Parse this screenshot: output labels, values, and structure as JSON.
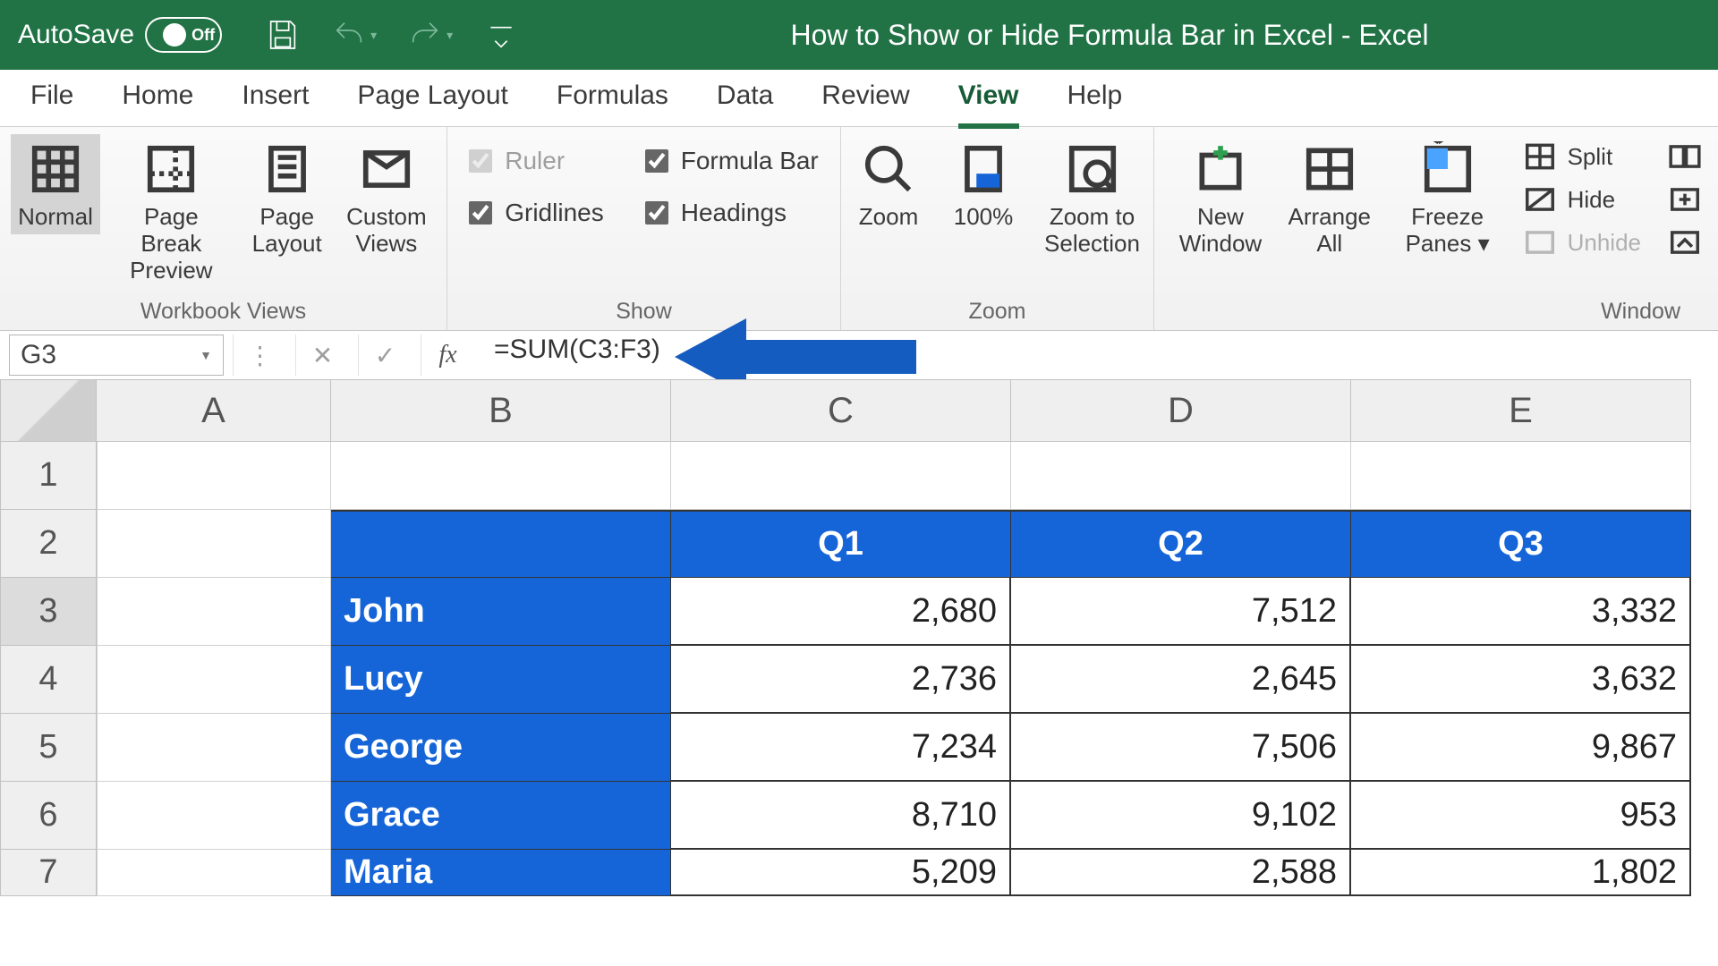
{
  "titlebar": {
    "autosave_label": "AutoSave",
    "autosave_state": "Off",
    "document_title": "How to Show or Hide Formula Bar in Excel  -  Excel"
  },
  "ribbon_tabs": [
    "File",
    "Home",
    "Insert",
    "Page Layout",
    "Formulas",
    "Data",
    "Review",
    "View",
    "Help"
  ],
  "active_tab": "View",
  "groups": {
    "workbook_views": {
      "label": "Workbook Views",
      "buttons": {
        "normal": "Normal",
        "page_break": "Page Break Preview",
        "page_layout": "Page Layout",
        "custom_views": "Custom Views"
      }
    },
    "show": {
      "label": "Show",
      "ruler": "Ruler",
      "formula_bar": "Formula Bar",
      "gridlines": "Gridlines",
      "headings": "Headings"
    },
    "zoom": {
      "label": "Zoom",
      "zoom": "Zoom",
      "hundred": "100%",
      "zoom_selection": "Zoom to Selection"
    },
    "window": {
      "label": "Window",
      "new_window": "New Window",
      "arrange_all": "Arrange All",
      "freeze_panes": "Freeze Panes",
      "split": "Split",
      "hide": "Hide",
      "unhide": "Unhide"
    }
  },
  "formula_bar": {
    "name_box": "G3",
    "fx_label": "fx",
    "formula": "=SUM(C3:F3)"
  },
  "columns": [
    "A",
    "B",
    "C",
    "D",
    "E"
  ],
  "rows": [
    "1",
    "2",
    "3",
    "4",
    "5",
    "6",
    "7"
  ],
  "table": {
    "headers": {
      "q1": "Q1",
      "q2": "Q2",
      "q3": "Q3"
    },
    "data": [
      {
        "name": "John",
        "q1": "2,680",
        "q2": "7,512",
        "q3": "3,332"
      },
      {
        "name": "Lucy",
        "q1": "2,736",
        "q2": "2,645",
        "q3": "3,632"
      },
      {
        "name": "George",
        "q1": "7,234",
        "q2": "7,506",
        "q3": "9,867"
      },
      {
        "name": "Grace",
        "q1": "8,710",
        "q2": "9,102",
        "q3": "953"
      },
      {
        "name": "Maria",
        "q1": "5,209",
        "q2": "2,588",
        "q3": "1,802"
      }
    ]
  }
}
